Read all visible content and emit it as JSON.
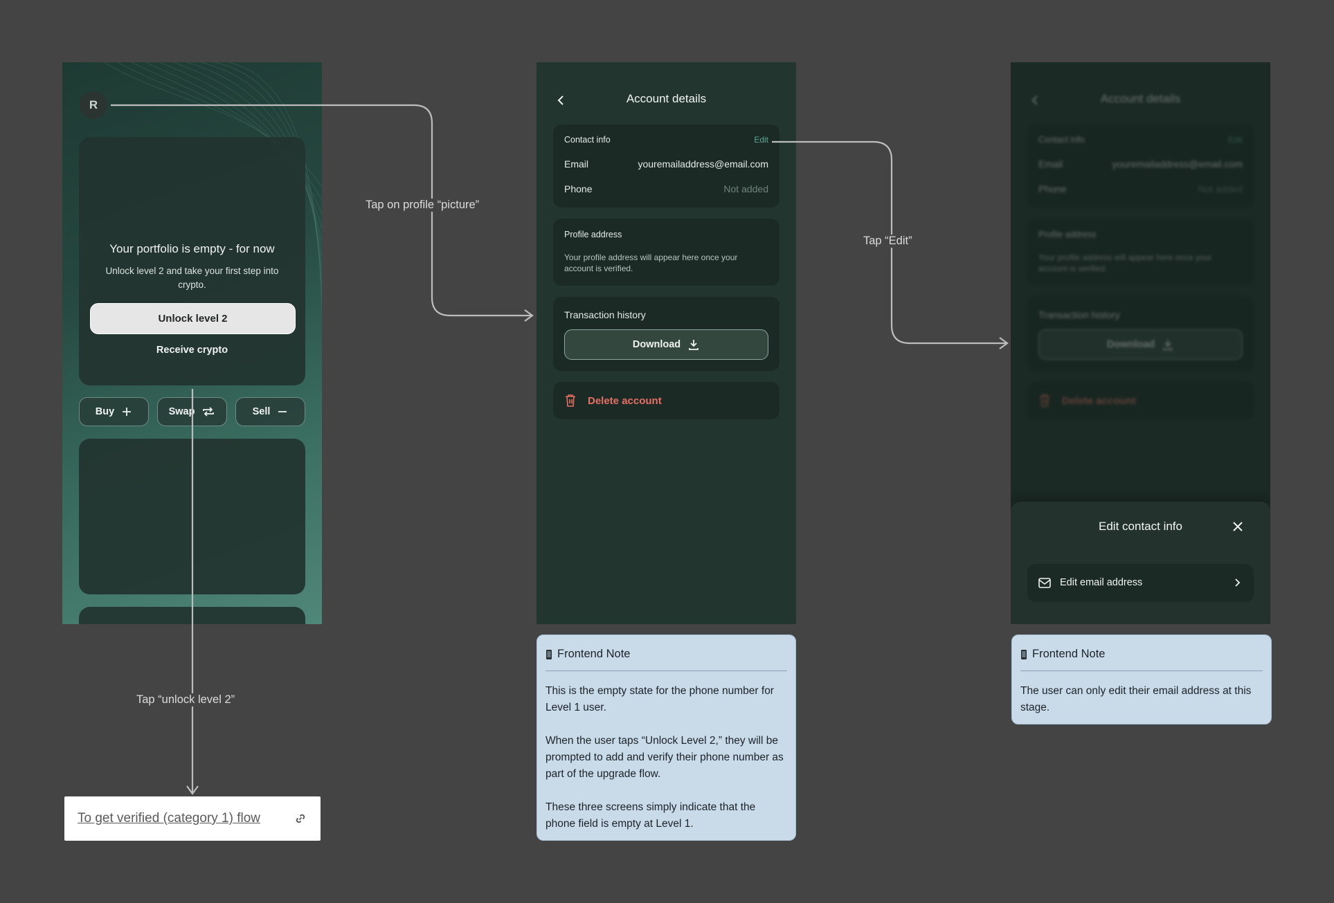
{
  "screen1": {
    "avatar_glyph": "R",
    "portfolio_title": "Your portfolio is empty - for now",
    "portfolio_subtitle": "Unlock level 2 and take your first step into crypto.",
    "unlock_button": "Unlock level 2",
    "receive_button": "Receive crypto",
    "actions": [
      {
        "label": "Buy",
        "icon": "plus-icon"
      },
      {
        "label": "Swap",
        "icon": "swap-icon"
      },
      {
        "label": "Sell",
        "icon": "minus-icon"
      }
    ]
  },
  "screen2": {
    "title": "Account details",
    "contact_info_label": "Contact info",
    "edit_label": "Edit",
    "email_key": "Email",
    "email_value": "youremailaddress@email.com",
    "phone_key": "Phone",
    "phone_value": "Not added",
    "profile_address_label": "Profile address",
    "profile_address_help": "Your profile address will appear here once your account is verified.",
    "transaction_history_label": "Transaction history",
    "download_button": "Download",
    "delete_account": "Delete account"
  },
  "screen3": {
    "title": "Account details",
    "contact_info_label": "Contact info",
    "edit_label": "Edit",
    "email_key": "Email",
    "email_value": "youremailaddress@email.com",
    "phone_key": "Phone",
    "phone_value": "Not added",
    "profile_address_label": "Profile address",
    "profile_address_help": "Your profile address will appear here once your account is verified.",
    "transaction_history_label": "Transaction history",
    "download_button": "Download",
    "delete_account": "Delete account",
    "sheet_title": "Edit contact info",
    "sheet_option": "Edit email address"
  },
  "connectors": {
    "tap_profile": "Tap on profile “picture”",
    "tap_edit": "Tap “Edit”",
    "tap_unlock": "Tap “unlock level 2”"
  },
  "link_box": {
    "text": "To get verified (category 1) flow"
  },
  "note1": {
    "heading": "Frontend Note",
    "icon": "phone-icon",
    "p1": "This is the empty state for the phone number for Level 1 user.",
    "p2": "When the user taps “Unlock Level 2,” they will be prompted to add and verify their phone number as part of the upgrade flow.",
    "p3": "These three screens simply indicate that the phone field is empty at Level 1."
  },
  "note2": {
    "heading": "Frontend Note",
    "icon": "phone-icon",
    "p1": "The user can only edit their email address at this stage."
  },
  "colors": {
    "canvas": "#444444",
    "screen_bg": "#23352f",
    "accent_green": "#5aa895",
    "danger_red": "#e57063",
    "note_bg": "#c9dbe9"
  }
}
